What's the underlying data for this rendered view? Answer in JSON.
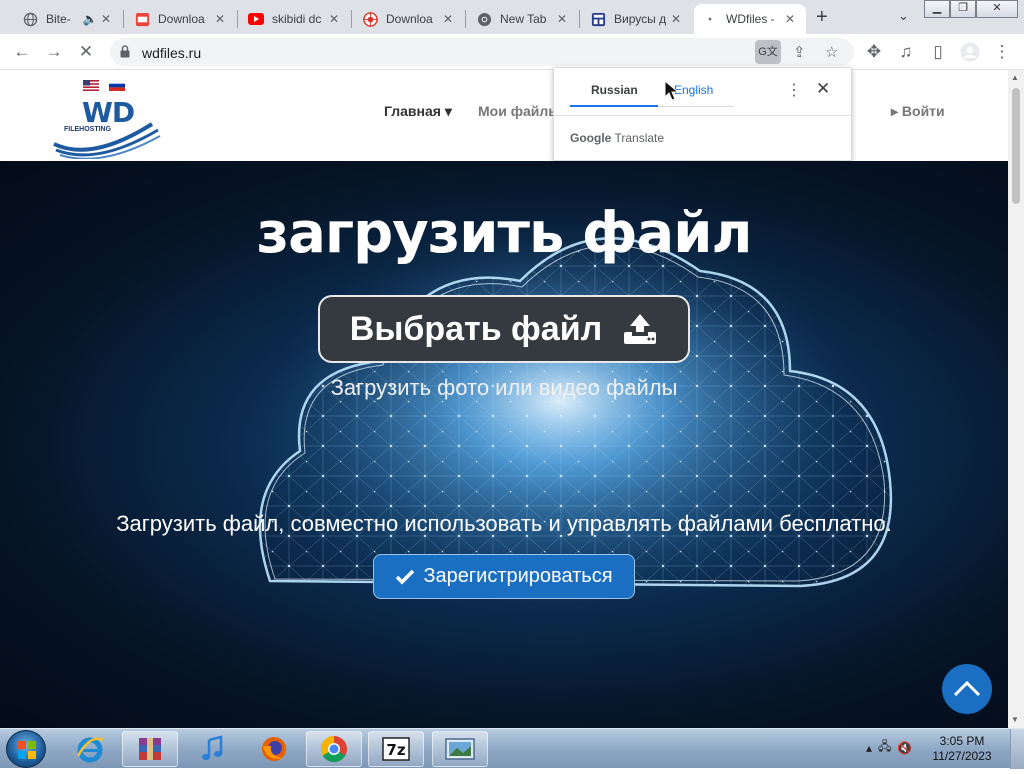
{
  "browser": {
    "tabs": [
      {
        "title": "Bite-",
        "icon": "globe-icon"
      },
      {
        "title": "Downloa",
        "icon": "download-site-icon"
      },
      {
        "title": "skibidi dc",
        "icon": "youtube-icon"
      },
      {
        "title": "Downloa",
        "icon": "download-target-icon"
      },
      {
        "title": "New Tab",
        "icon": "chrome-icon"
      },
      {
        "title": "Вирусы д",
        "icon": "site-icon"
      },
      {
        "title": "WDfiles -",
        "icon": "loading-icon"
      }
    ],
    "url": "wdfiles.ru"
  },
  "site": {
    "nav": {
      "home": "Главная ▾",
      "my_files": "Мои файлы",
      "login": "▸ Войти"
    },
    "logo": {
      "text": "WD",
      "subtext": "FILEHOSTING"
    },
    "hero": {
      "title": "загрузить файл",
      "choose_button": "Выбрать файл",
      "subtitle": "Загрузить фото или видео файлы",
      "description": "Загрузить файл, совместно использовать и управлять файлами бесплатно.",
      "register_button": "Зарегистрироваться"
    }
  },
  "translate_popup": {
    "source_lang": "Russian",
    "target_lang": "English",
    "footer_brand": "Google",
    "footer_text": "Translate"
  },
  "taskbar": {
    "time": "3:05 PM",
    "date": "11/27/2023"
  },
  "colors": {
    "accent": "#1b6fc2",
    "translate_blue": "#1a73e8",
    "hero_dark": "#061426"
  }
}
